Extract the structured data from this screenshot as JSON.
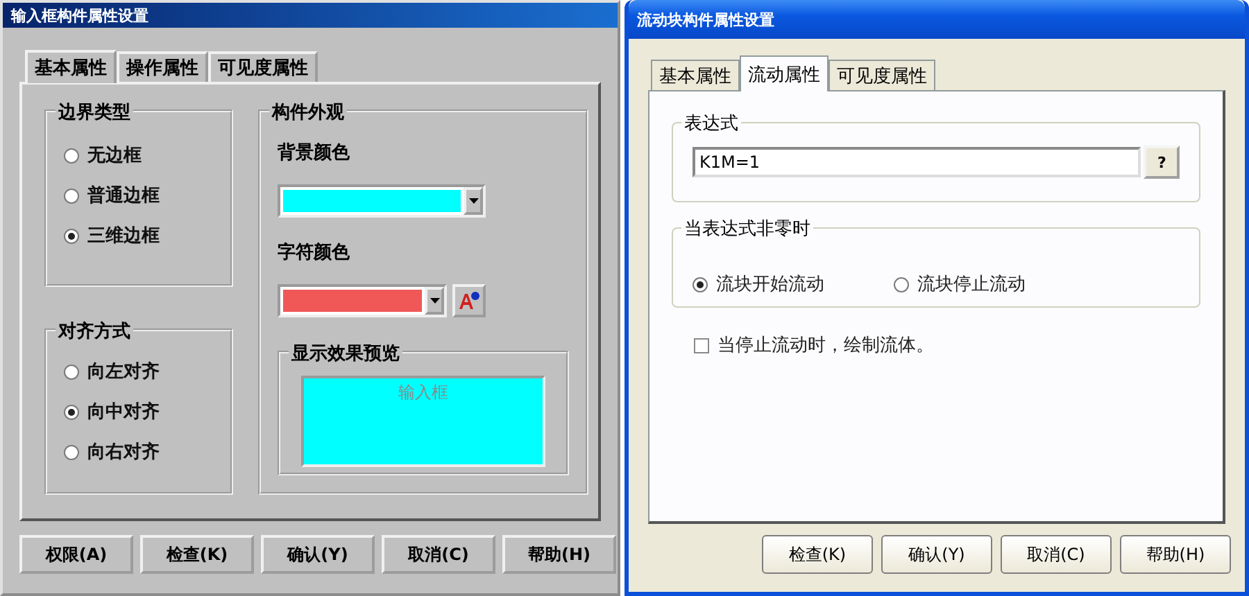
{
  "input_dialog": {
    "title": "输入框构件属性设置",
    "tabs": [
      {
        "label": "基本属性",
        "selected": true
      },
      {
        "label": "操作属性",
        "selected": false
      },
      {
        "label": "可见度属性",
        "selected": false
      }
    ],
    "border_type": {
      "title": "边界类型",
      "options": [
        {
          "label": "无边框",
          "selected": false
        },
        {
          "label": "普通边框",
          "selected": false
        },
        {
          "label": "三维边框",
          "selected": true
        }
      ]
    },
    "alignment": {
      "title": "对齐方式",
      "options": [
        {
          "label": "向左对齐",
          "selected": false
        },
        {
          "label": "向中对齐",
          "selected": true
        },
        {
          "label": "向右对齐",
          "selected": false
        }
      ]
    },
    "appearance": {
      "title": "构件外观",
      "background_color": {
        "label": "背景颜色",
        "color": "#00ffff"
      },
      "text_color": {
        "label": "字符颜色",
        "color": "#f05858"
      },
      "preview": {
        "title": "显示效果预览",
        "text": "输入框"
      }
    },
    "buttons": [
      "权限(A)",
      "检查(K)",
      "确认(Y)",
      "取消(C)",
      "帮助(H)"
    ]
  },
  "flow_block_dialog": {
    "title": "流动块构件属性设置",
    "tabs": [
      {
        "label": "基本属性",
        "selected": false
      },
      {
        "label": "流动属性",
        "selected": true
      },
      {
        "label": "可见度属性",
        "selected": false
      }
    ],
    "expression": {
      "title": "表达式",
      "value": "K1M=1",
      "help_button": "?"
    },
    "when_nonzero": {
      "title": "当表达式非零时",
      "options": [
        {
          "label": "流块开始流动",
          "selected": true
        },
        {
          "label": "流块停止流动",
          "selected": false
        }
      ]
    },
    "draw_fluid_on_stop": {
      "label": "当停止流动时，绘制流体。",
      "checked": false
    },
    "buttons": [
      "检查(K)",
      "确认(Y)",
      "取消(C)",
      "帮助(H)"
    ]
  }
}
